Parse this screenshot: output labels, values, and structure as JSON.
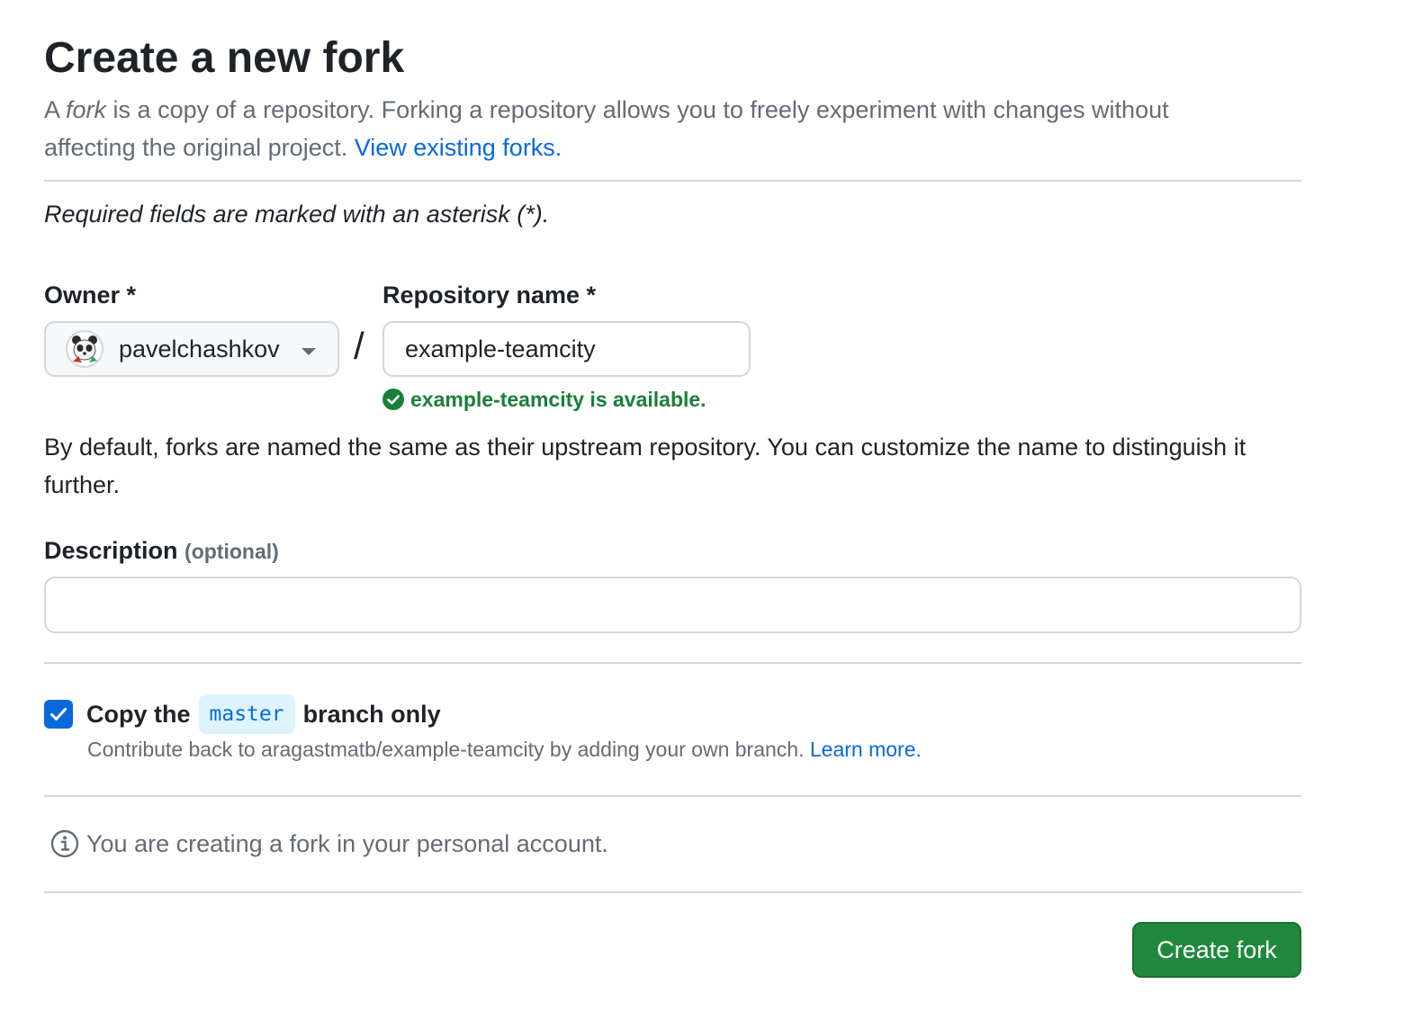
{
  "header": {
    "title": "Create a new fork",
    "intro_prefix": "A ",
    "intro_fork_word": "fork",
    "intro_text": " is a copy of a repository. Forking a repository allows you to freely experiment with changes without affecting the original project. ",
    "view_forks_link": "View existing forks."
  },
  "form": {
    "required_note": "Required fields are marked with an asterisk (*).",
    "owner_label": "Owner *",
    "owner_value": "pavelchashkov",
    "separator": "/",
    "repo_label": "Repository name *",
    "repo_value": "example-teamcity",
    "availability_message": "example-teamcity is available.",
    "default_note": "By default, forks are named the same as their upstream repository. You can customize the name to distinguish it further.",
    "description_label": "Description",
    "description_optional": "(optional)",
    "description_value": ""
  },
  "copy_branch": {
    "checked": true,
    "label_prefix": "Copy the",
    "branch": "master",
    "label_suffix": "branch only",
    "help_text": "Contribute back to aragastmatb/example-teamcity by adding your own branch. ",
    "learn_more_link": "Learn more."
  },
  "info": {
    "icon": "info-icon",
    "message": "You are creating a fork in your personal account."
  },
  "actions": {
    "create_label": "Create fork"
  },
  "colors": {
    "primary_button": "#1f883d",
    "link": "#0969da",
    "success": "#1a7f37",
    "muted_text": "#636c76",
    "border": "#d0d7de"
  }
}
